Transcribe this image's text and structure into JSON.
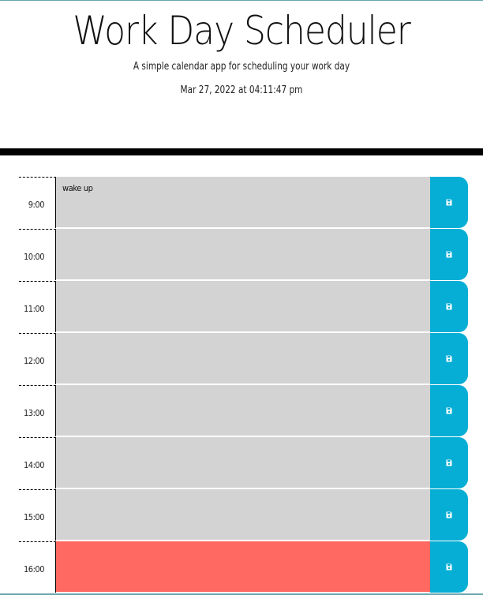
{
  "header": {
    "title": "Work Day Scheduler",
    "lead": "A simple calendar app for scheduling your work day",
    "current_day": "Mar 27, 2022 at 04:11:47 pm"
  },
  "colors": {
    "past": "#d3d3d3",
    "present": "#ff6961",
    "save_button": "#06aed5"
  },
  "timeblocks": [
    {
      "hour": "9:00",
      "text": "wake up",
      "status": "past",
      "save_icon": "floppy-disk-icon"
    },
    {
      "hour": "10:00",
      "text": "",
      "status": "past",
      "save_icon": "floppy-disk-icon"
    },
    {
      "hour": "11:00",
      "text": "",
      "status": "past",
      "save_icon": "floppy-disk-icon"
    },
    {
      "hour": "12:00",
      "text": "",
      "status": "past",
      "save_icon": "floppy-disk-icon"
    },
    {
      "hour": "13:00",
      "text": "",
      "status": "past",
      "save_icon": "floppy-disk-icon"
    },
    {
      "hour": "14:00",
      "text": "",
      "status": "past",
      "save_icon": "floppy-disk-icon"
    },
    {
      "hour": "15:00",
      "text": "",
      "status": "past",
      "save_icon": "floppy-disk-icon"
    },
    {
      "hour": "16:00",
      "text": "",
      "status": "present",
      "save_icon": "floppy-disk-icon"
    }
  ]
}
